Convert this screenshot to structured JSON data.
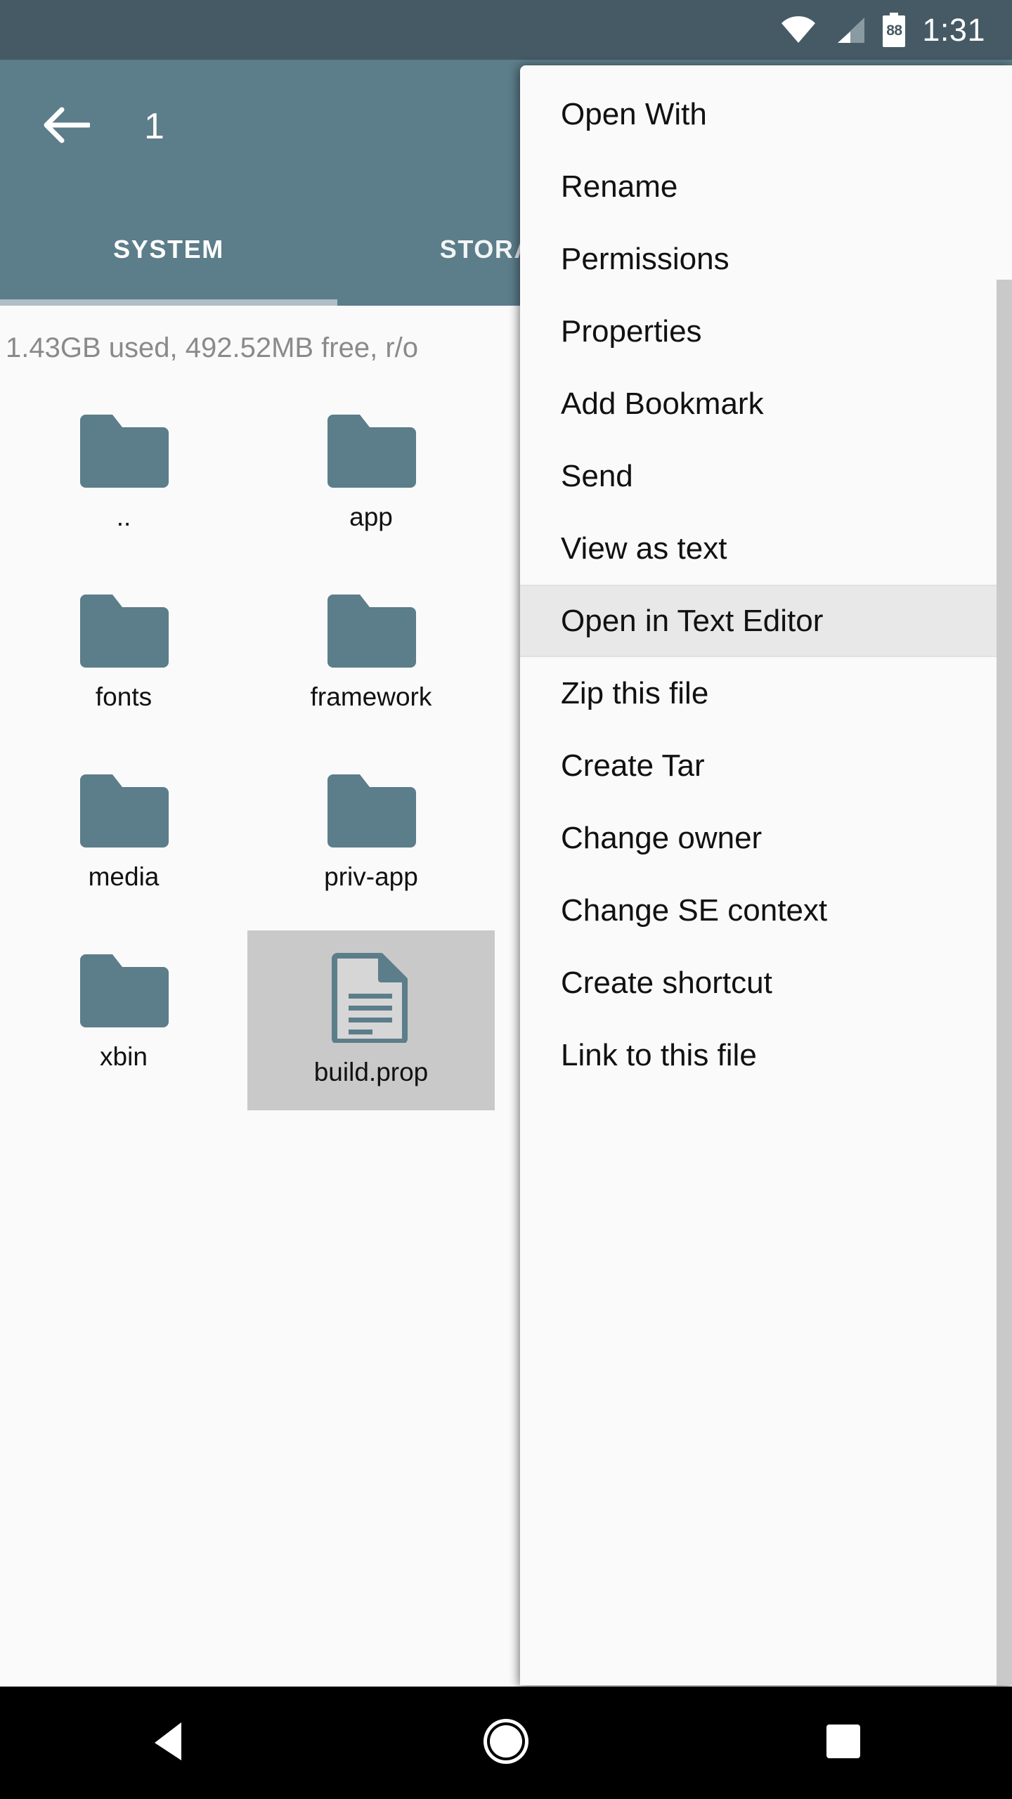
{
  "status_bar": {
    "wifi_icon": "wifi-icon",
    "signal_icon": "cell-signal-icon",
    "battery_icon": "battery-icon",
    "battery_level": "88",
    "time": "1:31"
  },
  "app_bar": {
    "back_icon": "back-arrow-icon",
    "title": "1",
    "copy_icon": "copy-icon",
    "accent_color": "#5c7d8a",
    "tabs": [
      {
        "label": "SYSTEM",
        "active": true
      },
      {
        "label": "STORAGE",
        "active": false
      }
    ]
  },
  "content": {
    "storage_info": "1.43GB used, 492.52MB free, r/o",
    "items": [
      {
        "name": "..",
        "type": "folder",
        "selected": false
      },
      {
        "name": "app",
        "type": "folder",
        "selected": false
      },
      {
        "name": "fonts",
        "type": "folder",
        "selected": false
      },
      {
        "name": "framework",
        "type": "folder",
        "selected": false
      },
      {
        "name": "media",
        "type": "folder",
        "selected": false
      },
      {
        "name": "priv-app",
        "type": "folder",
        "selected": false
      },
      {
        "name": "xbin",
        "type": "folder",
        "selected": false
      },
      {
        "name": "build.prop",
        "type": "file",
        "selected": true
      }
    ],
    "folder_color": "#5c7d8a",
    "selection_color": "#c9c9c9"
  },
  "context_menu": {
    "items": [
      {
        "label": "Open With",
        "highlighted": false
      },
      {
        "label": "Rename",
        "highlighted": false
      },
      {
        "label": "Permissions",
        "highlighted": false
      },
      {
        "label": "Properties",
        "highlighted": false
      },
      {
        "label": "Add Bookmark",
        "highlighted": false
      },
      {
        "label": "Send",
        "highlighted": false
      },
      {
        "label": "View as text",
        "highlighted": false
      },
      {
        "label": "Open in Text Editor",
        "highlighted": true
      },
      {
        "label": "Zip this file",
        "highlighted": false
      },
      {
        "label": "Create Tar",
        "highlighted": false
      },
      {
        "label": "Change owner",
        "highlighted": false
      },
      {
        "label": "Change SE context",
        "highlighted": false
      },
      {
        "label": "Create shortcut",
        "highlighted": false
      },
      {
        "label": "Link to this file",
        "highlighted": false
      }
    ]
  },
  "nav_bar": {
    "back_icon": "nav-back-triangle-icon",
    "home_icon": "nav-home-circle-icon",
    "recents_icon": "nav-recents-square-icon"
  }
}
